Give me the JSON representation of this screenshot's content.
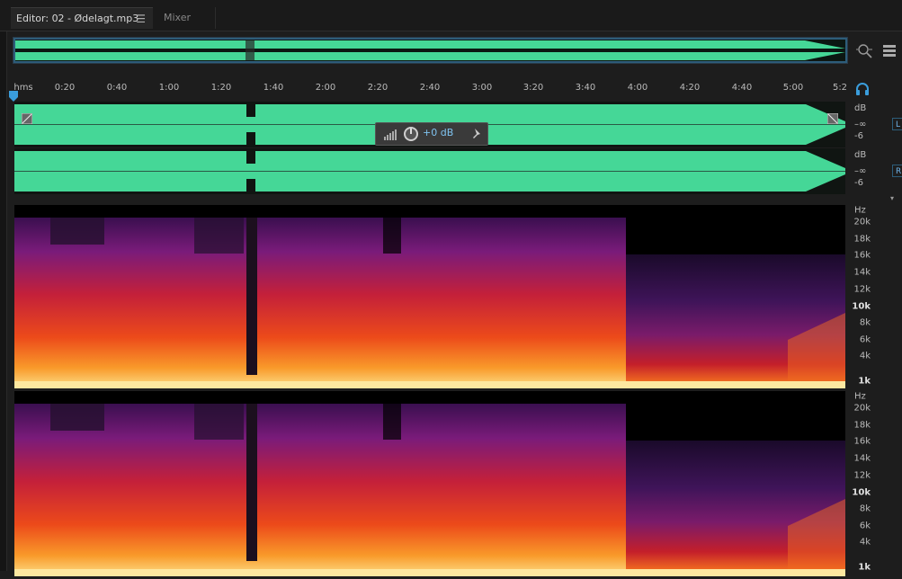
{
  "tabs": {
    "editor_label": "Editor: 02 - Ødelagt.mp3",
    "editor_menu": "☰",
    "mixer_label": "Mixer"
  },
  "ruler": {
    "unit": "hms",
    "ticks": [
      "0:20",
      "0:40",
      "1:00",
      "1:20",
      "1:40",
      "2:00",
      "2:20",
      "2:40",
      "3:00",
      "3:20",
      "3:40",
      "4:00",
      "4:20",
      "4:40",
      "5:00",
      "5:2"
    ]
  },
  "hud": {
    "gain": "+0 dB"
  },
  "db_scale": {
    "unit": "dB",
    "labels": [
      "–∞",
      "-6"
    ]
  },
  "channels": {
    "left": "L",
    "right": "R"
  },
  "hz_scale": {
    "unit": "Hz",
    "labels": [
      "20k",
      "18k",
      "16k",
      "14k",
      "12k",
      "10k",
      "8k",
      "6k",
      "4k",
      "1k"
    ]
  },
  "colors": {
    "waveform": "#45d797",
    "accent": "#3a9ddc"
  },
  "icons": {
    "zoom": "zoom-to-selection-icon",
    "list": "list-view-icon",
    "headphones": "headphones-icon",
    "playhead": "playhead-marker-icon",
    "fade_in": "fade-in-handle-icon",
    "fade_out": "fade-out-handle-icon",
    "pin": "pin-icon",
    "volume": "volume-meter-icon",
    "knob": "gain-knob-icon"
  }
}
